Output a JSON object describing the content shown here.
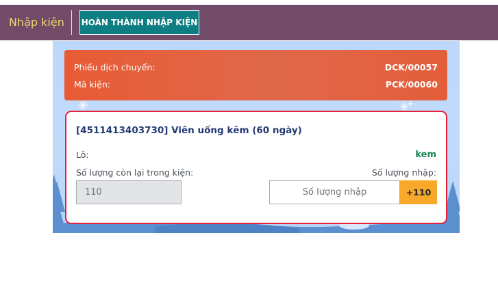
{
  "header": {
    "app_title": "Nhập kiện",
    "finish_button": "HOÀN THÀNH NHẬP KIỆN"
  },
  "info": {
    "transfer_label": "Phiếu dịch chuyển:",
    "transfer_value": "DCK/00057",
    "package_label": "Mã kiện:",
    "package_value": "PCK/00060"
  },
  "product": {
    "name": "[4511413403730] Viên uống kẽm (60 ngày)",
    "lot_label": "Lô:",
    "lot_value": "kem",
    "remaining_label": "Số lượng còn lại trong kiện:",
    "remaining_value": "110",
    "import_label": "Số lượng nhập:",
    "import_placeholder": "Số lượng nhập",
    "add_button": "+110"
  },
  "colors": {
    "header_bg": "#714b67",
    "title_color": "#f5d76e",
    "finish_button_bg": "#0f7e82",
    "info_card_bg": "#e75b35",
    "card_border": "#e4203a",
    "lot_value_color": "#198754",
    "add_button_bg": "#f8a92b"
  }
}
